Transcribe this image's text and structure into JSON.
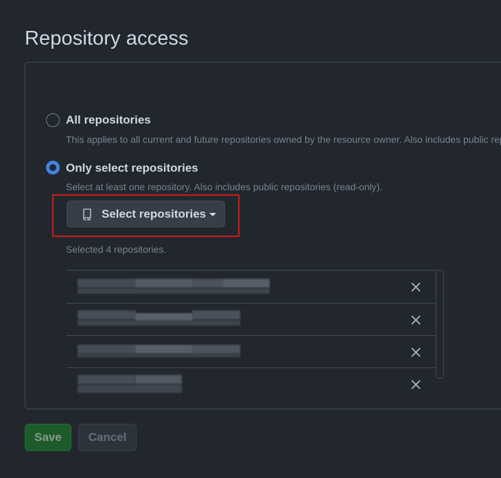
{
  "heading": "Repository access",
  "options": {
    "all": {
      "label": "All repositories",
      "description": "This applies to all current and future repositories owned by the resource owner. Also includes public repositories (read-only).",
      "selected": false
    },
    "select": {
      "label": "Only select repositories",
      "description": "Select at least one repository. Also includes public repositories (read-only).",
      "selected": true
    }
  },
  "select_button": {
    "label": "Select repositories",
    "icon": "repo-icon"
  },
  "selected_count_text": "Selected 4 repositories.",
  "repositories": [
    {
      "name": "[redacted]",
      "remove_icon": "x-icon"
    },
    {
      "name": "[redacted]",
      "remove_icon": "x-icon"
    },
    {
      "name": "[redacted]",
      "remove_icon": "x-icon"
    },
    {
      "name": "[redacted]",
      "remove_icon": "x-icon"
    }
  ],
  "actions": {
    "save_label": "Save",
    "cancel_label": "Cancel"
  },
  "colors": {
    "background": "#22272e",
    "accent": "#4184e4",
    "highlight_box": "#d21a1a",
    "save_button": "#1e5b2b"
  }
}
